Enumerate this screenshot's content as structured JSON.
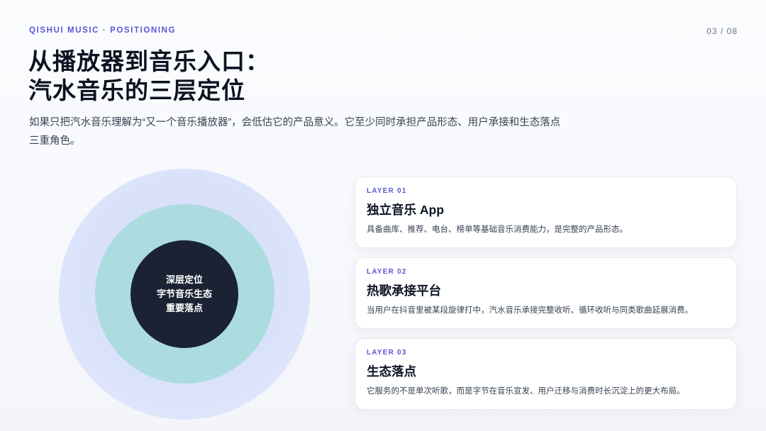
{
  "header": {
    "kicker": "QISHUI MUSIC · POSITIONING",
    "page": "03 / 08"
  },
  "title": {
    "line1": "从播放器到音乐入口：",
    "line2": "汽水音乐的三层定位"
  },
  "subtitle": "如果只把汽水音乐理解为“又一个音乐播放器”，会低估它的产品意义。它至少同时承担产品形态、用户承接和生态落点三重角色。",
  "diagram": {
    "center_lines": [
      "深层定位",
      "字节音乐生态",
      "重要落点"
    ]
  },
  "layers": [
    {
      "kicker": "LAYER 01",
      "title": "独立音乐 App",
      "desc": "具备曲库、推荐、电台、榜单等基础音乐消费能力，是完整的产品形态。"
    },
    {
      "kicker": "LAYER 02",
      "title": "热歌承接平台",
      "desc": "当用户在抖音里被某段旋律打中，汽水音乐承接完整收听、循环收听与同类歌曲延展消费。"
    },
    {
      "kicker": "LAYER 03",
      "title": "生态落点",
      "desc": "它服务的不是单次听歌，而是字节在音乐宣发、用户迁移与消费时长沉淀上的更大布局。"
    }
  ],
  "colors": {
    "accent": "#5a55d6",
    "ring_outer": "#dbe3fb",
    "ring_middle": "#acdbe0",
    "ring_inner": "#1a2233"
  }
}
